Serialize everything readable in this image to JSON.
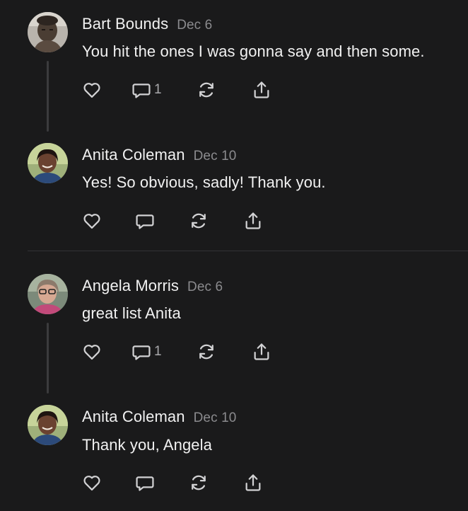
{
  "colors": {
    "background": "#1a1a1b",
    "text": "#f1f1f1",
    "muted": "#8b8b8e",
    "icon": "#d2d2d4",
    "thread": "#3b3b3d"
  },
  "comments": [
    {
      "author": "Bart Bounds",
      "date": "Dec 6",
      "text": "You hit the ones I was gonna say and then some.",
      "reply_count": "1"
    },
    {
      "author": "Anita Coleman",
      "date": "Dec 10",
      "text": "Yes! So obvious, sadly! Thank you.",
      "reply_count": ""
    },
    {
      "author": "Angela Morris",
      "date": "Dec 6",
      "text": "great list Anita",
      "reply_count": "1"
    },
    {
      "author": "Anita Coleman",
      "date": "Dec 10",
      "text": "Thank you, Angela",
      "reply_count": ""
    }
  ],
  "icons": {
    "like": "heart-icon",
    "reply": "comment-bubble-icon",
    "restack": "restack-icon",
    "share": "share-icon"
  }
}
